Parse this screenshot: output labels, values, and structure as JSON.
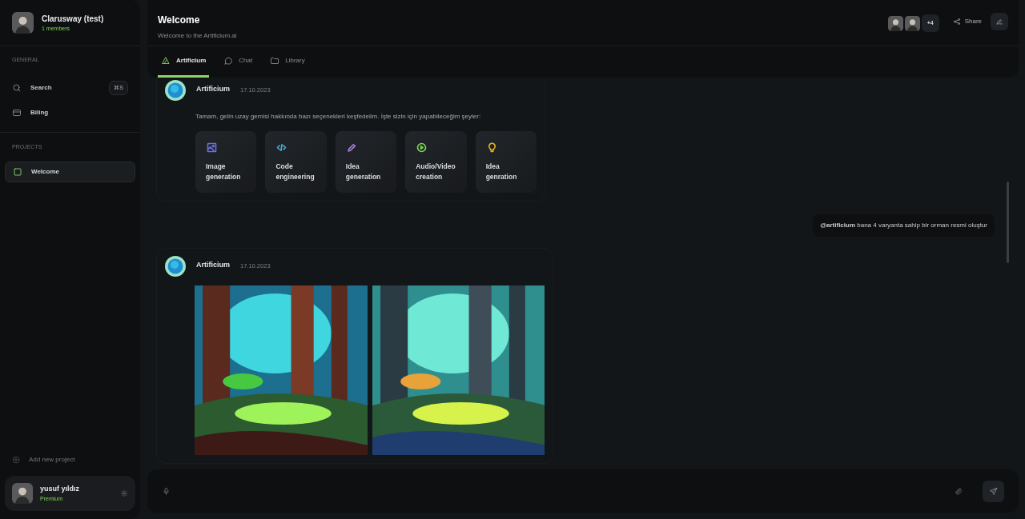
{
  "sidebar": {
    "team": {
      "name": "Clarusway (test)",
      "members": "1 members"
    },
    "general_heading": "GENERAL",
    "general_items": [
      {
        "kind": "search",
        "label": "Search",
        "shortcut": "⌘S"
      },
      {
        "kind": "billing",
        "label": "Biling"
      }
    ],
    "projects_heading": "PROJECTS",
    "projects": [
      {
        "label": "Welcome",
        "selected": true
      }
    ],
    "add_project": "Add new project",
    "user": {
      "name": "yusuf yıldız",
      "plan": "Premium"
    }
  },
  "header": {
    "title": "Welcome",
    "subtitle": "Welcome to the Artificium.ai",
    "extra_members": "+4",
    "share": "Share"
  },
  "tabs": [
    {
      "kind": "artificium",
      "label": "Artificium",
      "selected": true
    },
    {
      "kind": "chat",
      "label": "Chat",
      "selected": false
    },
    {
      "kind": "library",
      "label": "Library",
      "selected": false
    }
  ],
  "messages": [
    {
      "kind": "bot_options",
      "author": "Artificium",
      "date": "17.10.2023",
      "text": "Tamam, gelin uzay gemisi hakkında bazı seçenekleri keşfedelim. İşte sizin için yapabileceğim şeyler:",
      "options": [
        {
          "label": "Image generation",
          "color": "#6b6fe0"
        },
        {
          "label": "Code engineering",
          "color": "#4fb3d9"
        },
        {
          "label": "Idea generation",
          "color": "#a77ee0"
        },
        {
          "label": "Audio/Video creation",
          "color": "#7ed957"
        },
        {
          "label": "Idea genration",
          "color": "#e6b422"
        }
      ]
    },
    {
      "kind": "user",
      "text": "**@artificium** bana 4 varyanta sahip bir orman resmi oluştur"
    },
    {
      "kind": "bot_images",
      "author": "Artificium",
      "date": "17.10.2023"
    }
  ]
}
